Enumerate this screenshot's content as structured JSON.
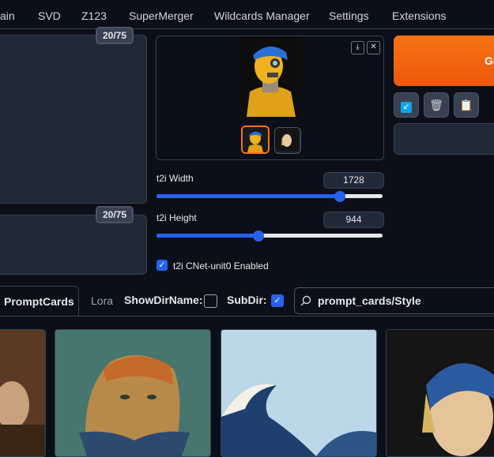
{
  "nav": {
    "tabs": [
      "ain",
      "SVD",
      "Z123",
      "SuperMerger",
      "Wildcards Manager",
      "Settings",
      "Extensions"
    ]
  },
  "prompt": {
    "positive_counter": "20/75",
    "negative_counter": "20/75"
  },
  "image_panel": {
    "download_icon": "download-icon",
    "close_icon": "close-icon",
    "thumbnails": [
      "robot-thumbnail",
      "girl-with-pearl-thumbnail"
    ]
  },
  "controls": {
    "width_label": "t2i Width",
    "width_value": "1728",
    "width_fraction": 0.81,
    "height_label": "t2i Height",
    "height_value": "944",
    "height_fraction": 0.45,
    "cnet_label": "t2i CNet-unit0 Enabled",
    "cnet_checked": true
  },
  "right": {
    "generate_label": "Ge",
    "tools": [
      "checkmark-icon",
      "trash-icon",
      "clipboard-icon"
    ]
  },
  "networks": {
    "tabs": [
      "PromptCards",
      "Lora"
    ],
    "show_dir_label": "ShowDirName:",
    "subdir_label": "SubDir:",
    "search_value": "prompt_cards/Style"
  },
  "colors": {
    "accent": "#2563eb",
    "generate": "#f97316",
    "background": "#0b0f19"
  }
}
